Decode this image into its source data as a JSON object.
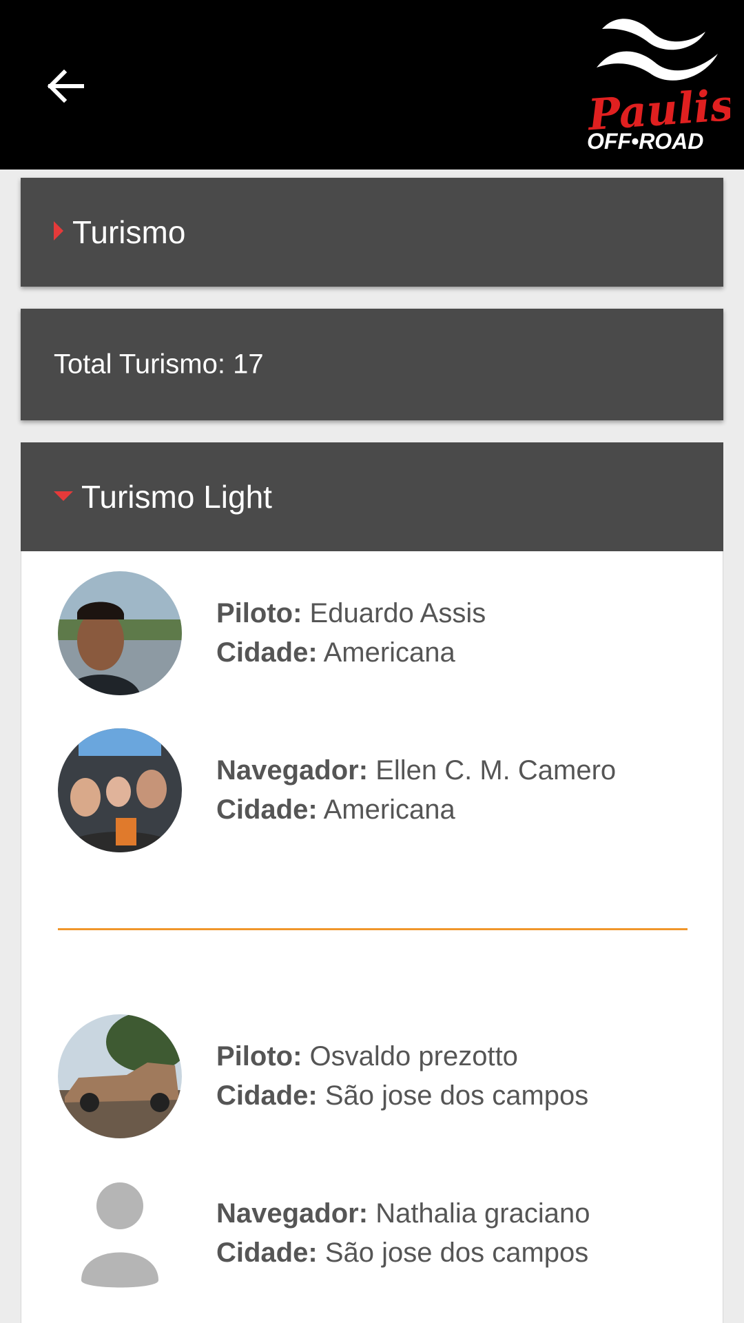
{
  "header": {
    "back_icon": "arrow-left-icon",
    "logo": {
      "line1": "Paulista",
      "line2": "OFF•ROAD"
    }
  },
  "categories": [
    {
      "title": "Turismo",
      "expanded": false
    },
    {
      "title": "Turismo Light",
      "expanded": true
    }
  ],
  "total": {
    "text": "Total Turismo: 17"
  },
  "teams": [
    {
      "pilot": {
        "role": "Piloto:",
        "name": "Eduardo Assis",
        "city_label": "Cidade:",
        "city": "Americana"
      },
      "navigator": {
        "role": "Navegador:",
        "name": "Ellen C. M. Camero",
        "city_label": "Cidade:",
        "city": "Americana"
      }
    },
    {
      "pilot": {
        "role": "Piloto:",
        "name": "Osvaldo prezotto",
        "city_label": "Cidade:",
        "city": "São jose dos campos"
      },
      "navigator": {
        "role": "Navegador:",
        "name": "Nathalia graciano",
        "city_label": "Cidade:",
        "city": "São jose dos campos"
      }
    }
  ],
  "colors": {
    "header_bg": "#000000",
    "panel_bg": "#4a4a4a",
    "caret": "#e53a3a",
    "divider": "#f0962a",
    "logo_red": "#e02020"
  }
}
